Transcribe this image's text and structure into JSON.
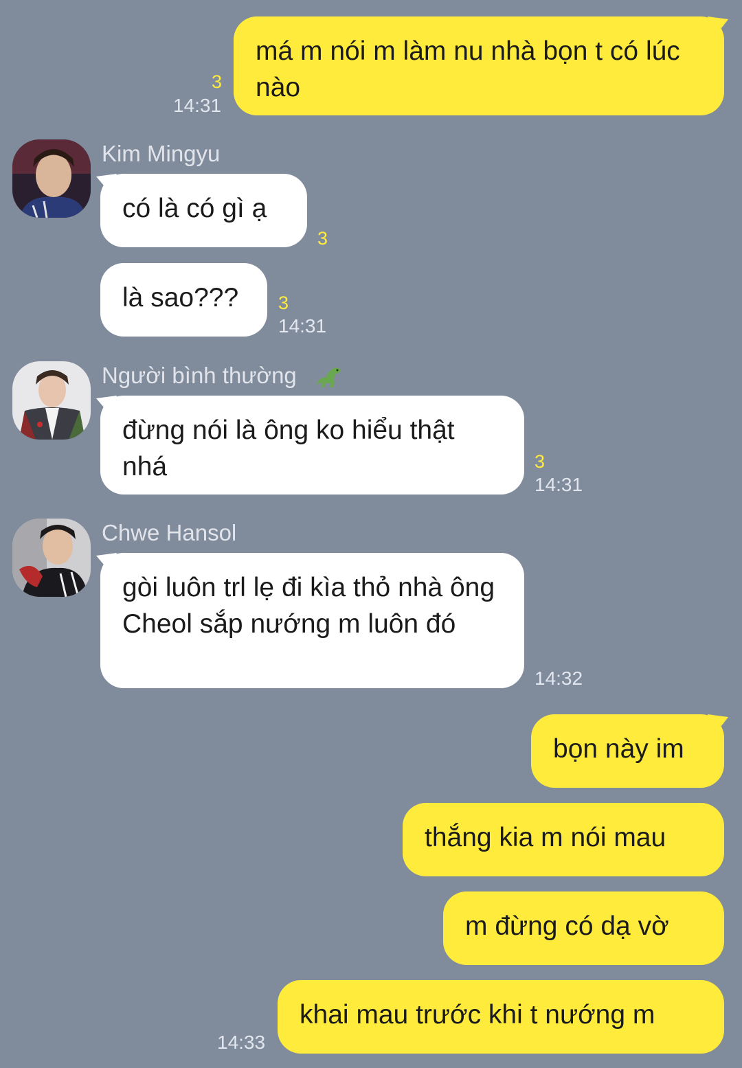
{
  "messages": [
    {
      "text": "má m nói m làm nu nhà bọn t có lúc nào",
      "unread": "3",
      "time": "14:31"
    },
    {
      "sender": "Kim Mingyu",
      "text": "có là có gì ạ",
      "unread": "3"
    },
    {
      "text": "là sao???",
      "unread": "3",
      "time": "14:31"
    },
    {
      "sender": "Người bình thường",
      "sender_icon": "dinosaur-icon",
      "text": "đừng nói là ông ko hiểu thật nhá",
      "unread": "3",
      "time": "14:31"
    },
    {
      "sender": "Chwe Hansol",
      "text": "gòi luôn trl lẹ đi kìa thỏ nhà ông Cheol sắp nướng m luôn đó",
      "time": "14:32"
    },
    {
      "text": "bọn này im"
    },
    {
      "text": "thắng kia m nói mau"
    },
    {
      "text": "m đừng có dạ vờ"
    },
    {
      "text": "khai mau trước khi t nướng m",
      "time": "14:33"
    }
  ],
  "colors": {
    "background": "#808b9c",
    "my_bubble": "#ffeb3b",
    "other_bubble": "#ffffff",
    "unread_count": "#ffeb3b"
  }
}
